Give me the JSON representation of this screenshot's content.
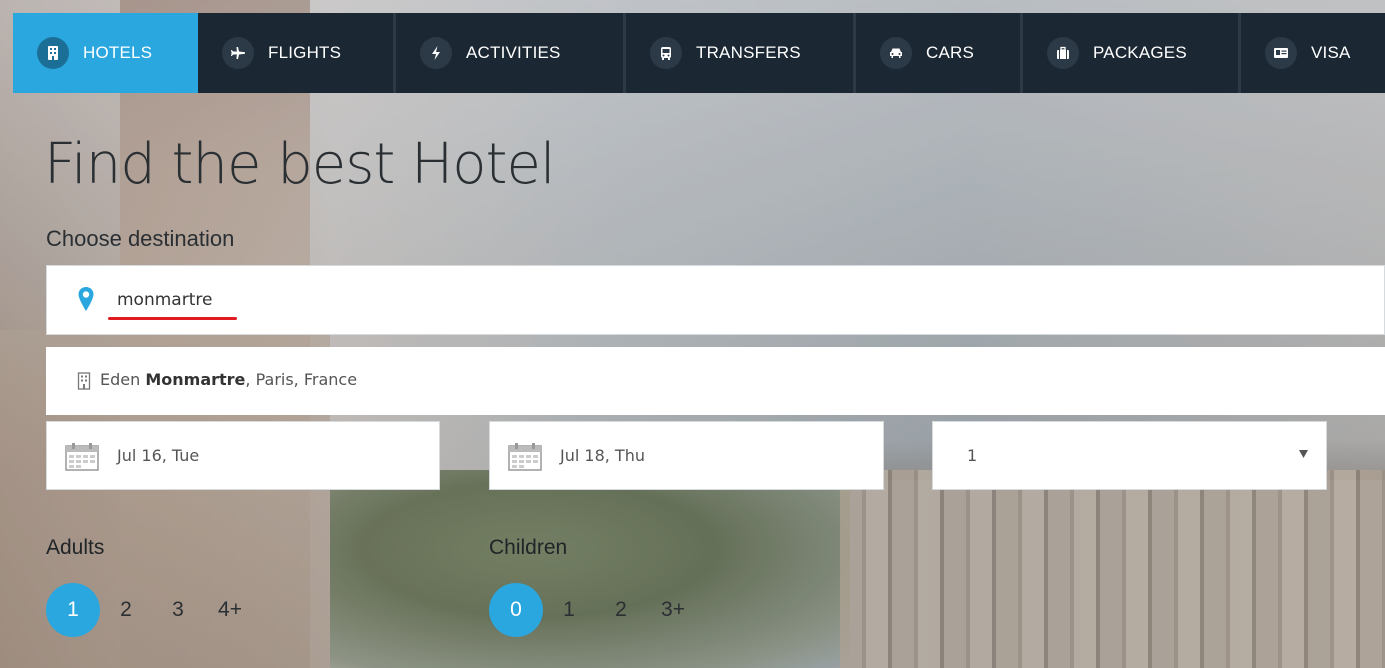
{
  "nav": {
    "tabs": [
      {
        "label": "HOTELS",
        "icon": "building-icon",
        "active": true
      },
      {
        "label": "FLIGHTS",
        "icon": "plane-icon",
        "active": false
      },
      {
        "label": "ACTIVITIES",
        "icon": "bolt-icon",
        "active": false
      },
      {
        "label": "TRANSFERS",
        "icon": "bus-icon",
        "active": false
      },
      {
        "label": "CARS",
        "icon": "car-icon",
        "active": false
      },
      {
        "label": "PACKAGES",
        "icon": "suitcase-icon",
        "active": false
      },
      {
        "label": "VISA",
        "icon": "id-card-icon",
        "active": false
      }
    ]
  },
  "heading": "Find the best Hotel",
  "destination": {
    "label": "Choose destination",
    "value": "monmartre"
  },
  "suggestion": {
    "prefix": "Eden ",
    "match": "Monmartre",
    "suffix": ", Paris, France"
  },
  "checkin": {
    "value": "Jul 16, Tue"
  },
  "checkout": {
    "value": "Jul 18, Thu"
  },
  "rooms": {
    "value": "1"
  },
  "adults": {
    "label": "Adults",
    "options": [
      "1",
      "2",
      "3",
      "4+"
    ],
    "selected": "1"
  },
  "children": {
    "label": "Children",
    "options": [
      "0",
      "1",
      "2",
      "3+"
    ],
    "selected": "0"
  },
  "colors": {
    "accent": "#2aa7df",
    "nav_bg": "#1b2733",
    "highlight": "#e01b22"
  }
}
